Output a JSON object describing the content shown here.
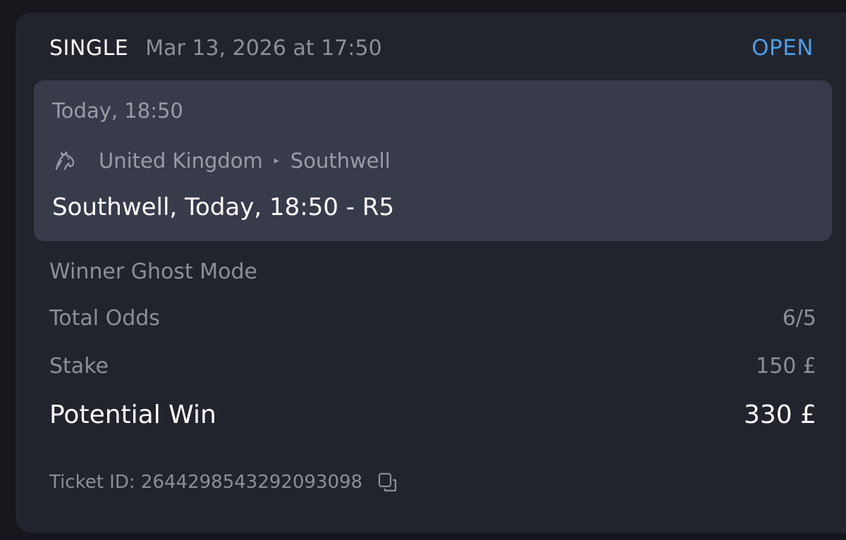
{
  "header": {
    "bet_type": "SINGLE",
    "placed_at": "Mar 13, 2026 at 17:50",
    "status": "OPEN"
  },
  "event": {
    "time": "Today, 18:50",
    "sport_icon": "horse-racing-icon",
    "country": "United Kingdom",
    "track": "Southwell",
    "title": "Southwell, Today, 18:50 - R5"
  },
  "details": {
    "market": "Winner Ghost Mode",
    "total_odds_label": "Total Odds",
    "total_odds_value": "6/5",
    "stake_label": "Stake",
    "stake_value": "150 £",
    "potential_win_label": "Potential Win",
    "potential_win_value": "330 £"
  },
  "ticket": {
    "label": "Ticket ID: 26442985432920930​98",
    "copy_icon": "copy-icon"
  },
  "colors": {
    "background": "#16171c",
    "card": "#22242d",
    "event_box": "#383b4a",
    "status_open": "#4a9fe6",
    "muted_text": "#8d8f97",
    "primary_text": "#ffffff"
  }
}
